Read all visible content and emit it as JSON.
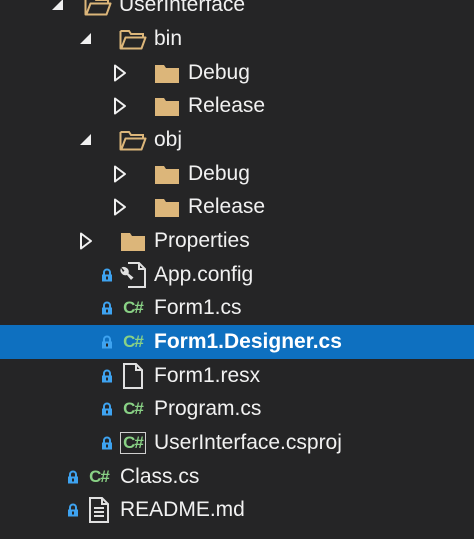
{
  "colors": {
    "background": "#252526",
    "selection": "#0e70c0",
    "text": "#f1f1f1",
    "folder": "#dcb67a",
    "lock": "#3ea3f0",
    "csharp": "#89d185"
  },
  "tree": {
    "rows": [
      {
        "label": "UserInterface",
        "icon": "folder-open-icon",
        "caret": "expanded",
        "lock": false,
        "selected": false
      },
      {
        "label": "bin",
        "icon": "folder-open-icon",
        "caret": "expanded",
        "lock": false,
        "selected": false
      },
      {
        "label": "Debug",
        "icon": "folder-icon",
        "caret": "collapsed",
        "lock": false,
        "selected": false
      },
      {
        "label": "Release",
        "icon": "folder-icon",
        "caret": "collapsed",
        "lock": false,
        "selected": false
      },
      {
        "label": "obj",
        "icon": "folder-open-icon",
        "caret": "expanded",
        "lock": false,
        "selected": false
      },
      {
        "label": "Debug",
        "icon": "folder-icon",
        "caret": "collapsed",
        "lock": false,
        "selected": false
      },
      {
        "label": "Release",
        "icon": "folder-icon",
        "caret": "collapsed",
        "lock": false,
        "selected": false
      },
      {
        "label": "Properties",
        "icon": "folder-icon",
        "caret": "collapsed",
        "lock": false,
        "selected": false
      },
      {
        "label": "App.config",
        "icon": "config-file-icon",
        "caret": "none",
        "lock": true,
        "selected": false
      },
      {
        "label": "Form1.cs",
        "icon": "csharp-file-icon",
        "caret": "none",
        "lock": true,
        "selected": false
      },
      {
        "label": "Form1.Designer.cs",
        "icon": "csharp-file-icon",
        "caret": "none",
        "lock": true,
        "selected": true
      },
      {
        "label": "Form1.resx",
        "icon": "resource-file-icon",
        "caret": "none",
        "lock": true,
        "selected": false
      },
      {
        "label": "Program.cs",
        "icon": "csharp-file-icon",
        "caret": "none",
        "lock": true,
        "selected": false
      },
      {
        "label": "UserInterface.csproj",
        "icon": "csharp-project-icon",
        "caret": "none",
        "lock": true,
        "selected": false
      },
      {
        "label": "Class.cs",
        "icon": "csharp-file-icon",
        "caret": "none",
        "lock": true,
        "selected": false
      },
      {
        "label": "README.md",
        "icon": "text-file-icon",
        "caret": "none",
        "lock": true,
        "selected": false
      }
    ]
  }
}
